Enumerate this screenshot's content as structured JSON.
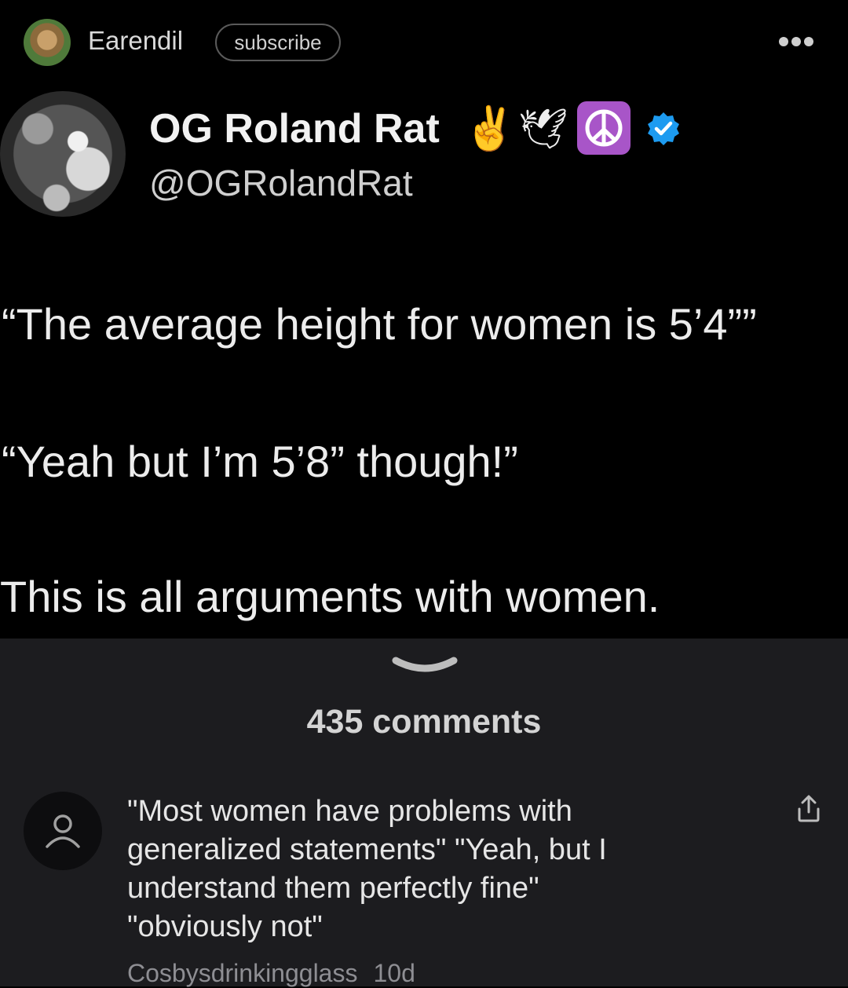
{
  "header": {
    "username": "Earendil",
    "subscribe_label": "subscribe",
    "more_icon": "more-horizontal-icon"
  },
  "tweet": {
    "display_name": "OG Roland Rat",
    "emojis": [
      "✌️",
      "🕊",
      "☮"
    ],
    "handle": "@OGRolandRat",
    "line1": "“The average height for women is 5’4””",
    "line2": "“Yeah but I’m 5’8” though!”",
    "line3": "This is all arguments with women."
  },
  "comments": {
    "count_label": "435 comments",
    "items": [
      {
        "text_lines": [
          "\"Most women have problems with",
          "generalized statements\" \"Yeah, but I",
          "understand them perfectly fine\"",
          "\"obviously not\""
        ],
        "author": "Cosbysdrinkingglass",
        "age": "10d"
      }
    ]
  },
  "colors": {
    "background": "#000000",
    "comments_background": "#1c1c1f",
    "peace_badge": "#a855c8",
    "verified": "#1d9bf0",
    "meta_text": "#8e8e93"
  }
}
